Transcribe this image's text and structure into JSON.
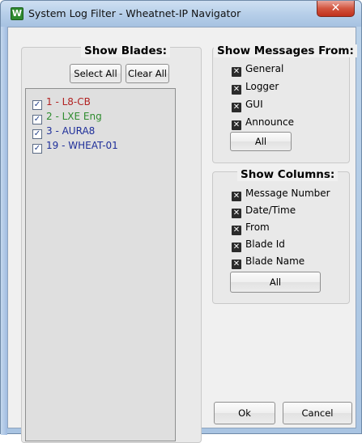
{
  "window": {
    "title": "System Log Filter - Wheatnet-IP Navigator",
    "icon_letter": "W",
    "close_glyph": "✕"
  },
  "blades": {
    "title": "Show Blades:",
    "select_all_label": "Select All",
    "clear_all_label": "Clear All",
    "items": [
      {
        "label": "1 - L8-CB",
        "checked": true,
        "color": "#b22222"
      },
      {
        "label": "2 - LXE Eng",
        "checked": true,
        "color": "#2e8b2e"
      },
      {
        "label": "3 - AURA8",
        "checked": true,
        "color": "#1f2f9a"
      },
      {
        "label": "19 - WHEAT-01",
        "checked": true,
        "color": "#1f2f9a"
      }
    ]
  },
  "messages": {
    "title": "Show Messages From:",
    "items": [
      "General",
      "Logger",
      "GUI",
      "Announce"
    ],
    "all_label": "All"
  },
  "columns": {
    "title": "Show Columns:",
    "items": [
      "Message Number",
      "Date/Time",
      "From",
      "Blade Id",
      "Blade Name"
    ],
    "all_label": "All"
  },
  "footer": {
    "ok_label": "Ok",
    "cancel_label": "Cancel"
  },
  "colors": {
    "checkbox_check": "#23418a",
    "x_box": "#2b2b2b"
  }
}
